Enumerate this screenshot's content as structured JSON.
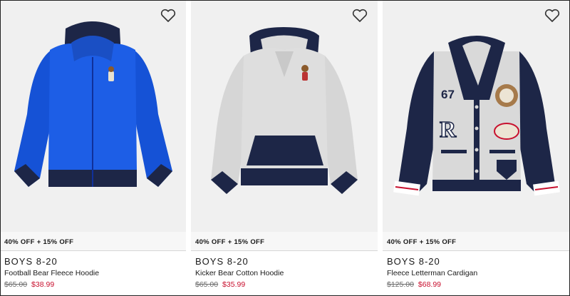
{
  "products": [
    {
      "promo": "40% OFF + 15% OFF",
      "brand": "BOYS 8-20",
      "name": "Football Bear Fleece Hoodie",
      "original_price": "$65.00",
      "sale_price": "$38.99",
      "image_icon": "blue-zip-hoodie-image"
    },
    {
      "promo": "40% OFF + 15% OFF",
      "brand": "BOYS 8-20",
      "name": "Kicker Bear Cotton Hoodie",
      "original_price": "$65.00",
      "sale_price": "$35.99",
      "image_icon": "grey-pullover-hoodie-image"
    },
    {
      "promo": "40% OFF + 15% OFF",
      "brand": "BOYS 8-20",
      "name": "Fleece Letterman Cardigan",
      "original_price": "$125.00",
      "sale_price": "$68.99",
      "image_icon": "letterman-cardigan-image"
    }
  ],
  "image_patches": {
    "number": "67",
    "letter": "R"
  },
  "colors": {
    "sale_red": "#c8102e",
    "navy": "#1d2647",
    "royal_blue": "#1552d6",
    "heather_grey": "#d9d9d9"
  },
  "icons": {
    "wishlist": "heart-outline-icon"
  }
}
